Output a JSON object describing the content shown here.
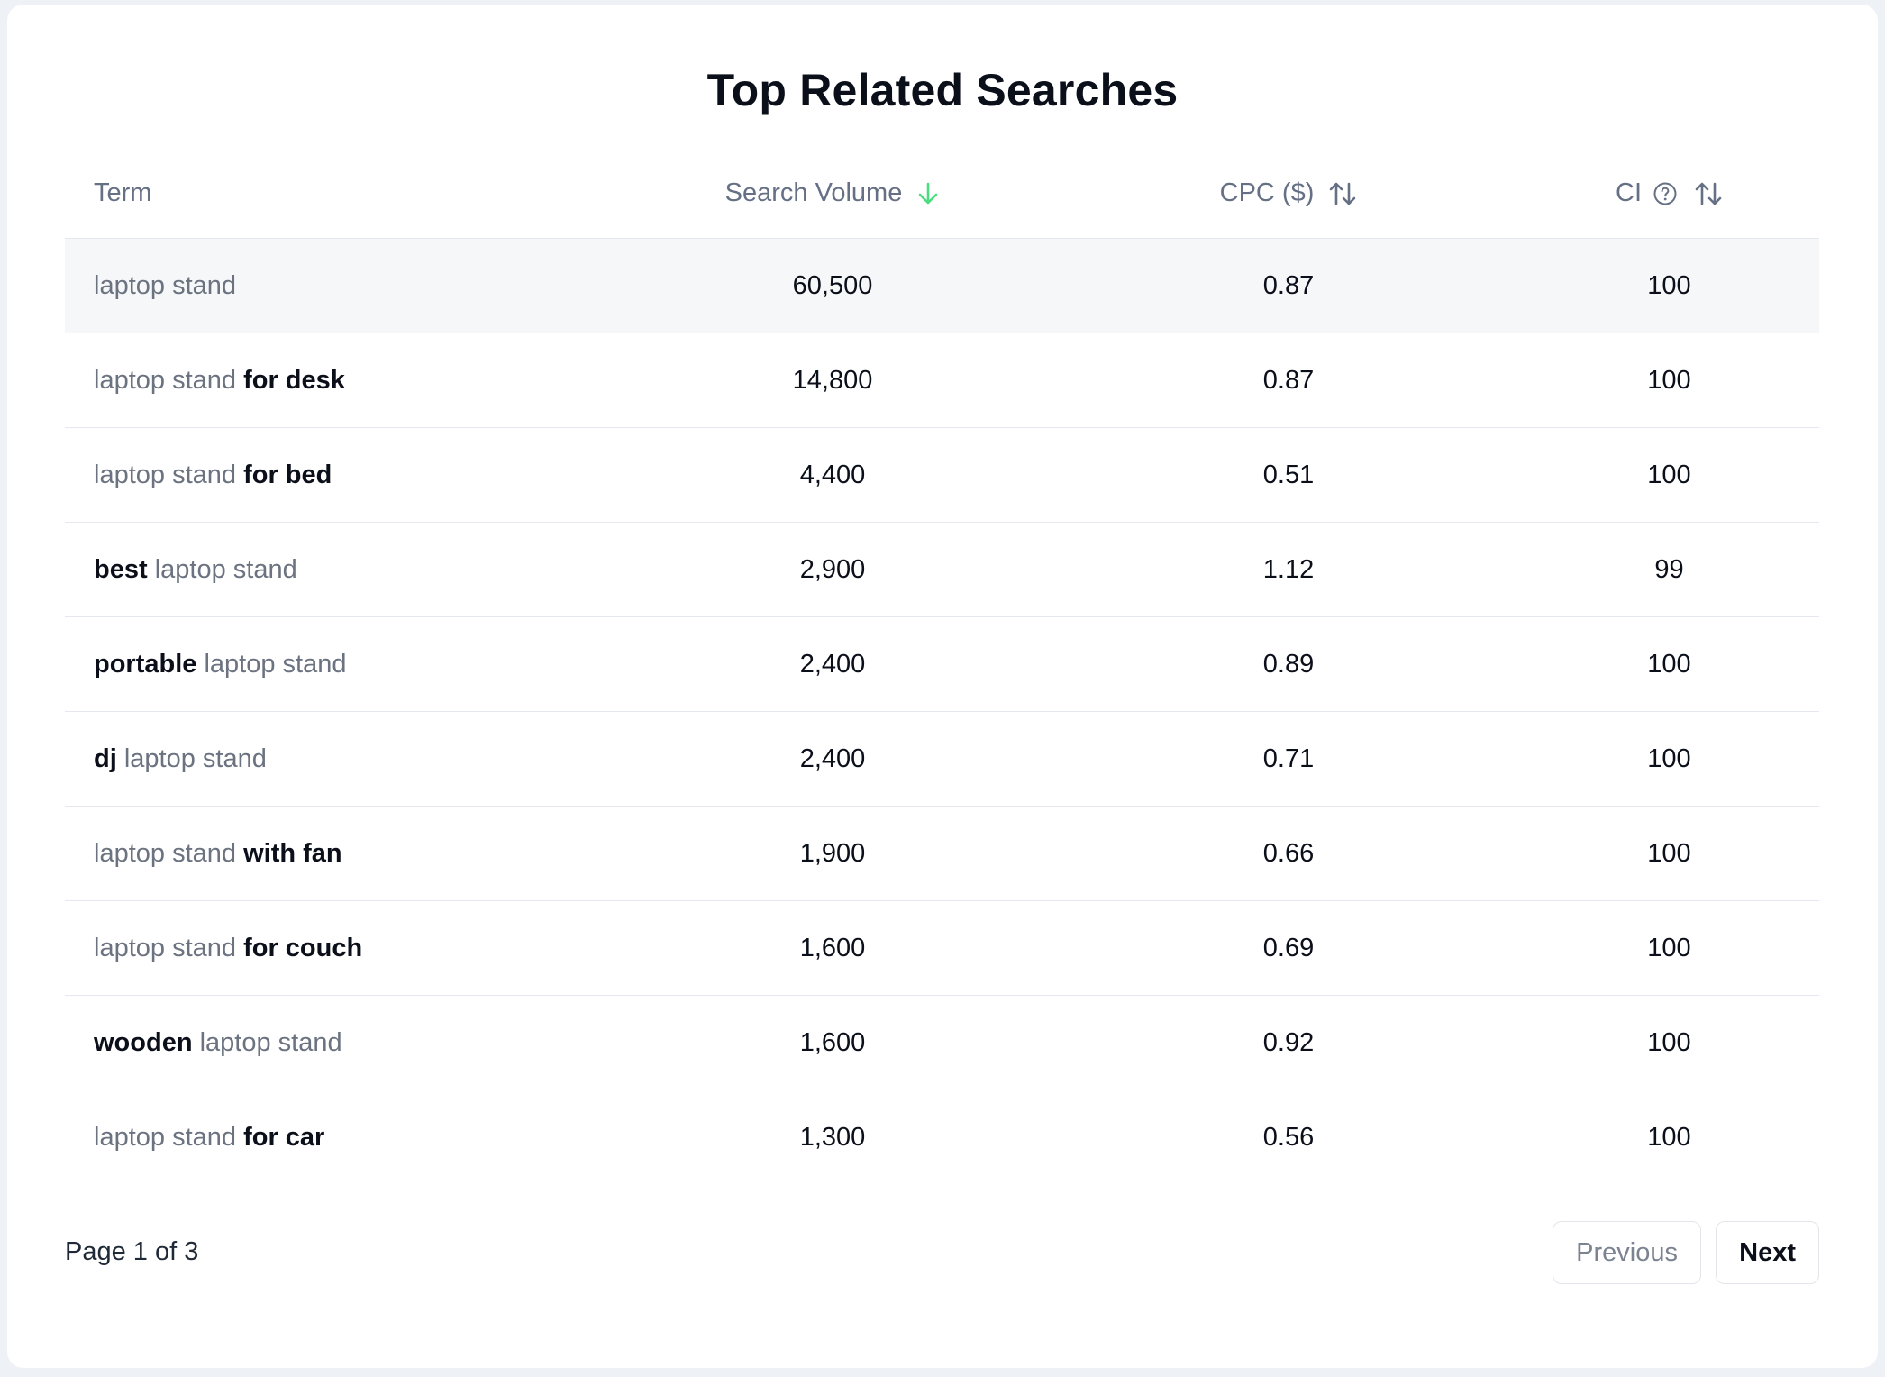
{
  "title": "Top Related Searches",
  "colors": {
    "sort_active": "#4ade80",
    "header_text": "#667085",
    "muted_term": "#6b7280"
  },
  "columns": {
    "term": "Term",
    "search_volume": "Search Volume",
    "cpc": "CPC ($)",
    "ci": "CI"
  },
  "icons": {
    "search_volume_sort": "arrow-down-icon",
    "cpc_sort": "sort-icon",
    "ci_help": "question-circle-icon",
    "ci_sort": "sort-icon"
  },
  "rows": [
    {
      "prefix": "",
      "base": "laptop stand",
      "suffix": "",
      "volume": "60,500",
      "cpc": "0.87",
      "ci": "100"
    },
    {
      "prefix": "",
      "base": "laptop stand",
      "suffix": "for desk",
      "volume": "14,800",
      "cpc": "0.87",
      "ci": "100"
    },
    {
      "prefix": "",
      "base": "laptop stand",
      "suffix": "for bed",
      "volume": "4,400",
      "cpc": "0.51",
      "ci": "100"
    },
    {
      "prefix": "best",
      "base": "laptop stand",
      "suffix": "",
      "volume": "2,900",
      "cpc": "1.12",
      "ci": "99"
    },
    {
      "prefix": "portable",
      "base": "laptop stand",
      "suffix": "",
      "volume": "2,400",
      "cpc": "0.89",
      "ci": "100"
    },
    {
      "prefix": "dj",
      "base": "laptop stand",
      "suffix": "",
      "volume": "2,400",
      "cpc": "0.71",
      "ci": "100"
    },
    {
      "prefix": "",
      "base": "laptop stand",
      "suffix": "with fan",
      "volume": "1,900",
      "cpc": "0.66",
      "ci": "100"
    },
    {
      "prefix": "",
      "base": "laptop stand",
      "suffix": "for couch",
      "volume": "1,600",
      "cpc": "0.69",
      "ci": "100"
    },
    {
      "prefix": "wooden",
      "base": "laptop stand",
      "suffix": "",
      "volume": "1,600",
      "cpc": "0.92",
      "ci": "100"
    },
    {
      "prefix": "",
      "base": "laptop stand",
      "suffix": "for car",
      "volume": "1,300",
      "cpc": "0.56",
      "ci": "100"
    }
  ],
  "pagination": {
    "page_info": "Page 1 of 3",
    "previous_label": "Previous",
    "next_label": "Next"
  }
}
